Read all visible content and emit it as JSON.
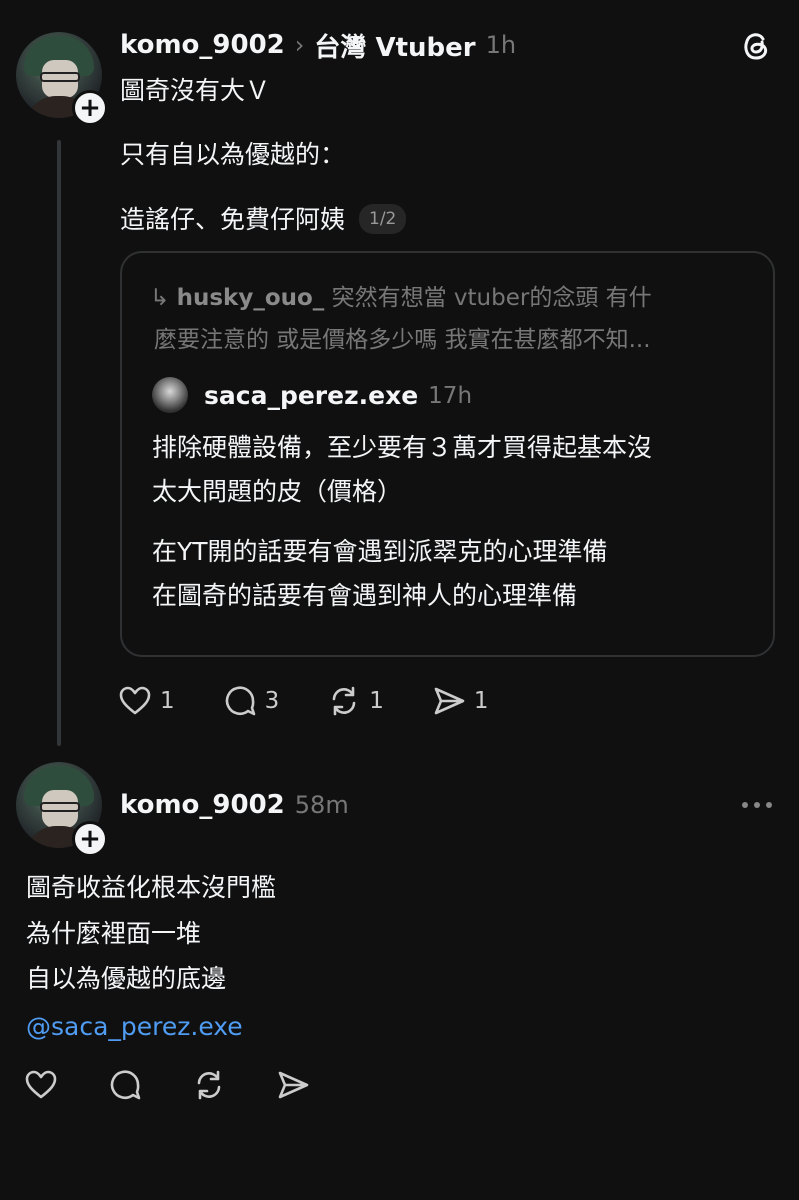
{
  "post1": {
    "username": "komo_9002",
    "topic_separator": "›",
    "topic": "台灣 Vtuber",
    "time": "1h",
    "lines": [
      "圖奇沒有大Ｖ",
      "只有自以為優越的：",
      "造謠仔、免費仔阿姨"
    ],
    "counter": "1/2",
    "quote": {
      "reply_arrow": "↳",
      "reply_user": "husky_ouo_",
      "reply_text_line1": "突然有想當 vtuber的念頭 有什",
      "reply_text_line2": "麼要注意的 或是價格多少嗎 我實在甚麼都不知...",
      "author": "saca_perez.exe",
      "author_time": "17h",
      "text_lines": [
        "排除硬體設備，至少要有３萬才買得起基本沒",
        "太大問題的皮（價格）",
        "在YT開的話要有會遇到派翠克的心理準備",
        "在圖奇的話要有會遇到神人的心理準備"
      ]
    },
    "actions": {
      "likes": "1",
      "comments": "3",
      "reposts": "1",
      "shares": "1"
    }
  },
  "post2": {
    "username": "komo_9002",
    "time": "58m",
    "lines": [
      "圖奇收益化根本沒門檻",
      "為什麼裡面一堆",
      "自以為優越的底邊"
    ],
    "mention": "@saca_perez.exe"
  },
  "icons": {
    "threads_logo": "threads-logo-icon",
    "more": "more-horizontal-icon",
    "plus": "+"
  },
  "colors": {
    "background": "#101010",
    "text": "#f3f5f7",
    "muted": "#777777",
    "link": "#4f9cf2"
  }
}
